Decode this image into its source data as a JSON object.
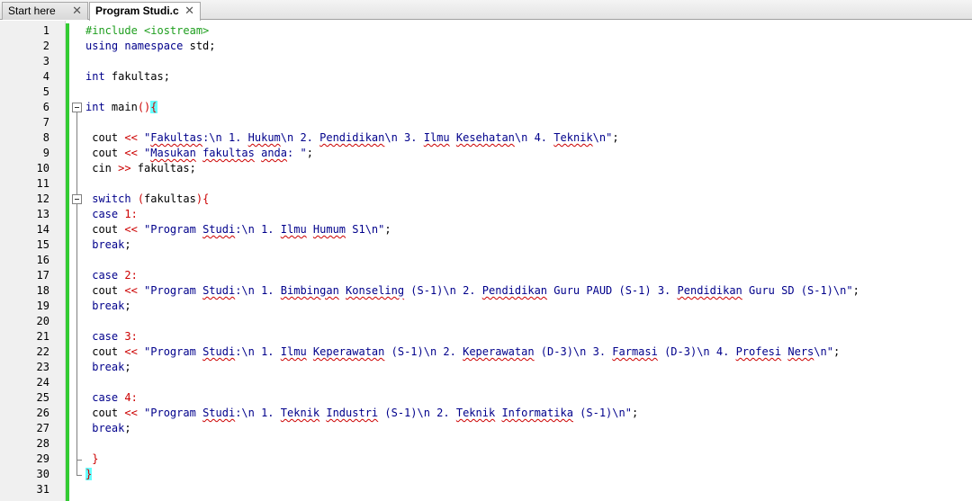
{
  "tabs": [
    {
      "label": "Start here",
      "close": "✕",
      "active": false
    },
    {
      "label": "Program Studi.c",
      "close": "✕",
      "active": true
    }
  ],
  "lines": [
    {
      "n": "1",
      "t": [
        [
          "pp",
          "#include <iostream>"
        ]
      ]
    },
    {
      "n": "2",
      "t": [
        [
          "kw",
          "using namespace "
        ],
        [
          "",
          "std;"
        ]
      ]
    },
    {
      "n": "3",
      "t": []
    },
    {
      "n": "4",
      "t": [
        [
          "kw",
          "int"
        ],
        [
          "",
          " fakultas;"
        ]
      ]
    },
    {
      "n": "5",
      "t": []
    },
    {
      "n": "6",
      "t": [
        [
          "kw",
          "int"
        ],
        [
          "",
          " main"
        ],
        [
          "paren",
          "()"
        ],
        [
          "hl",
          "{"
        ]
      ]
    },
    {
      "n": "7",
      "t": []
    },
    {
      "n": "8",
      "t": [
        [
          "",
          " cout "
        ],
        [
          "op",
          "<<"
        ],
        [
          "str",
          " \""
        ],
        [
          "sqs",
          "Fakultas"
        ],
        [
          "str",
          ":\\n 1. "
        ],
        [
          "sqs",
          "Hukum"
        ],
        [
          "str",
          "\\n 2. "
        ],
        [
          "sqs",
          "Pendidikan"
        ],
        [
          "str",
          "\\n 3. "
        ],
        [
          "sqs",
          "Ilmu"
        ],
        [
          "str",
          " "
        ],
        [
          "sqs",
          "Kesehatan"
        ],
        [
          "str",
          "\\n 4. "
        ],
        [
          "sqs",
          "Teknik"
        ],
        [
          "str",
          "\\n\""
        ],
        [
          "",
          ";"
        ]
      ]
    },
    {
      "n": "9",
      "t": [
        [
          "",
          " cout "
        ],
        [
          "op",
          "<<"
        ],
        [
          "str",
          " \""
        ],
        [
          "sqs",
          "Masukan"
        ],
        [
          "str",
          " "
        ],
        [
          "sqs",
          "fakultas"
        ],
        [
          "str",
          " "
        ],
        [
          "sqs",
          "anda"
        ],
        [
          "str",
          ": \""
        ],
        [
          "",
          ";"
        ]
      ]
    },
    {
      "n": "10",
      "t": [
        [
          "",
          " cin "
        ],
        [
          "op",
          ">>"
        ],
        [
          "",
          " fakultas;"
        ]
      ]
    },
    {
      "n": "11",
      "t": []
    },
    {
      "n": "12",
      "t": [
        [
          "kw",
          " switch"
        ],
        [
          "",
          " "
        ],
        [
          "paren",
          "("
        ],
        [
          "",
          "fakultas"
        ],
        [
          "paren",
          "){"
        ]
      ]
    },
    {
      "n": "13",
      "t": [
        [
          "kw",
          " case"
        ],
        [
          "",
          " "
        ],
        [
          "num",
          "1"
        ],
        [
          "op",
          ":"
        ]
      ]
    },
    {
      "n": "14",
      "t": [
        [
          "",
          " cout "
        ],
        [
          "op",
          "<<"
        ],
        [
          "str",
          " \"Program "
        ],
        [
          "sqs",
          "Studi"
        ],
        [
          "str",
          ":\\n 1. "
        ],
        [
          "sqs",
          "Ilmu"
        ],
        [
          "str",
          " "
        ],
        [
          "sqs",
          "Humum"
        ],
        [
          "str",
          " S1\\n\""
        ],
        [
          "",
          ";"
        ]
      ]
    },
    {
      "n": "15",
      "t": [
        [
          "kw",
          " break"
        ],
        [
          "",
          ";"
        ]
      ]
    },
    {
      "n": "16",
      "t": []
    },
    {
      "n": "17",
      "t": [
        [
          "kw",
          " case"
        ],
        [
          "",
          " "
        ],
        [
          "num",
          "2"
        ],
        [
          "op",
          ":"
        ]
      ]
    },
    {
      "n": "18",
      "t": [
        [
          "",
          " cout "
        ],
        [
          "op",
          "<<"
        ],
        [
          "str",
          " \"Program "
        ],
        [
          "sqs",
          "Studi"
        ],
        [
          "str",
          ":\\n 1. "
        ],
        [
          "sqs",
          "Bimbingan"
        ],
        [
          "str",
          " "
        ],
        [
          "sqs",
          "Konseling"
        ],
        [
          "str",
          " (S-1)\\n 2. "
        ],
        [
          "sqs",
          "Pendidikan"
        ],
        [
          "str",
          " Guru PAUD (S-1) 3. "
        ],
        [
          "sqs",
          "Pendidikan"
        ],
        [
          "str",
          " Guru SD (S-1)\\n\""
        ],
        [
          "",
          ";"
        ]
      ]
    },
    {
      "n": "19",
      "t": [
        [
          "kw",
          " break"
        ],
        [
          "",
          ";"
        ]
      ]
    },
    {
      "n": "20",
      "t": []
    },
    {
      "n": "21",
      "t": [
        [
          "kw",
          " case"
        ],
        [
          "",
          " "
        ],
        [
          "num",
          "3"
        ],
        [
          "op",
          ":"
        ]
      ]
    },
    {
      "n": "22",
      "t": [
        [
          "",
          " cout "
        ],
        [
          "op",
          "<<"
        ],
        [
          "str",
          " \"Program "
        ],
        [
          "sqs",
          "Studi"
        ],
        [
          "str",
          ":\\n 1. "
        ],
        [
          "sqs",
          "Ilmu"
        ],
        [
          "str",
          " "
        ],
        [
          "sqs",
          "Keperawatan"
        ],
        [
          "str",
          " (S-1)\\n 2. "
        ],
        [
          "sqs",
          "Keperawatan"
        ],
        [
          "str",
          " (D-3)\\n 3. "
        ],
        [
          "sqs",
          "Farmasi"
        ],
        [
          "str",
          " (D-3)\\n 4. "
        ],
        [
          "sqs",
          "Profesi"
        ],
        [
          "str",
          " "
        ],
        [
          "sqs",
          "Ners"
        ],
        [
          "str",
          "\\n\""
        ],
        [
          "",
          ";"
        ]
      ]
    },
    {
      "n": "23",
      "t": [
        [
          "kw",
          " break"
        ],
        [
          "",
          ";"
        ]
      ]
    },
    {
      "n": "24",
      "t": []
    },
    {
      "n": "25",
      "t": [
        [
          "kw",
          " case"
        ],
        [
          "",
          " "
        ],
        [
          "num",
          "4"
        ],
        [
          "op",
          ":"
        ]
      ]
    },
    {
      "n": "26",
      "t": [
        [
          "",
          " cout "
        ],
        [
          "op",
          "<<"
        ],
        [
          "str",
          " \"Program "
        ],
        [
          "sqs",
          "Studi"
        ],
        [
          "str",
          ":\\n 1. "
        ],
        [
          "sqs",
          "Teknik"
        ],
        [
          "str",
          " "
        ],
        [
          "sqs",
          "Industri"
        ],
        [
          "str",
          " (S-1)\\n 2. "
        ],
        [
          "sqs",
          "Teknik"
        ],
        [
          "str",
          " "
        ],
        [
          "sqs",
          "Informatika"
        ],
        [
          "str",
          " (S-1)\\n\""
        ],
        [
          "",
          ";"
        ]
      ]
    },
    {
      "n": "27",
      "t": [
        [
          "kw",
          " break"
        ],
        [
          "",
          ";"
        ]
      ]
    },
    {
      "n": "28",
      "t": []
    },
    {
      "n": "29",
      "t": [
        [
          "paren",
          " }"
        ]
      ]
    },
    {
      "n": "30",
      "t": [
        [
          "hl",
          "}"
        ]
      ]
    },
    {
      "n": "31",
      "t": []
    }
  ]
}
